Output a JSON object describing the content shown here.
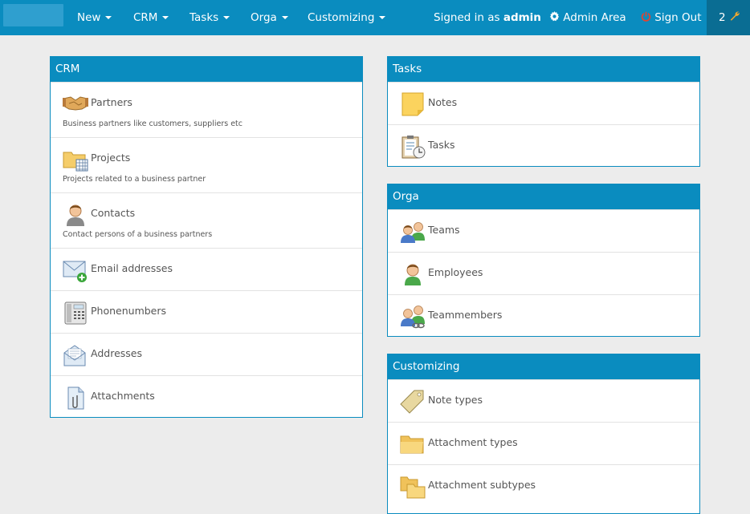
{
  "nav": {
    "items": [
      {
        "label": "New"
      },
      {
        "label": "CRM"
      },
      {
        "label": "Tasks"
      },
      {
        "label": "Orga"
      },
      {
        "label": "Customizing"
      }
    ],
    "signed_in_prefix": "Signed in as",
    "signed_in_user": "admin",
    "admin_area": "Admin Area",
    "sign_out": "Sign Out",
    "badge_count": "2"
  },
  "crm": {
    "title": "CRM",
    "items": [
      {
        "label": "Partners",
        "desc": "Business partners like customers, suppliers etc",
        "icon": "handshake-icon"
      },
      {
        "label": "Projects",
        "desc": "Projects related to a business partner",
        "icon": "project-folder-icon"
      },
      {
        "label": "Contacts",
        "desc": "Contact persons of a business partners",
        "icon": "contact-person-icon"
      },
      {
        "label": "Email addresses",
        "icon": "email-add-icon"
      },
      {
        "label": "Phonenumbers",
        "icon": "phone-icon"
      },
      {
        "label": "Addresses",
        "icon": "address-envelope-icon"
      },
      {
        "label": "Attachments",
        "icon": "attachment-icon"
      }
    ]
  },
  "tasks": {
    "title": "Tasks",
    "items": [
      {
        "label": "Notes",
        "icon": "sticky-note-icon"
      },
      {
        "label": "Tasks",
        "icon": "task-clipboard-icon"
      }
    ]
  },
  "orga": {
    "title": "Orga",
    "items": [
      {
        "label": "Teams",
        "icon": "team-icon"
      },
      {
        "label": "Employees",
        "icon": "employee-icon"
      },
      {
        "label": "Teammembers",
        "icon": "teammember-icon"
      }
    ]
  },
  "customizing": {
    "title": "Customizing",
    "items": [
      {
        "label": "Note types",
        "icon": "tag-icon"
      },
      {
        "label": "Attachment types",
        "icon": "folder-icon"
      },
      {
        "label": "Attachment subtypes",
        "icon": "subfolder-icon"
      }
    ]
  }
}
